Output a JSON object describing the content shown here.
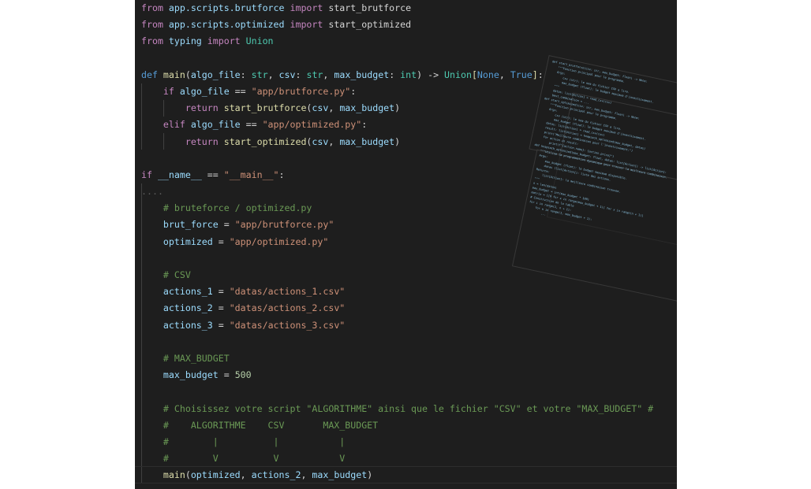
{
  "code_lines": [
    {
      "type": "import1",
      "text": "from app.scripts.brutforce import start_brutforce"
    },
    {
      "type": "import2",
      "text": "from app.scripts.optimized import start_optimized"
    },
    {
      "type": "import3",
      "text": "from typing import Union"
    },
    {
      "type": "blank",
      "text": ""
    },
    {
      "type": "def",
      "text": "def main(algo_file: str, csv: str, max_budget: int) -> Union[None, True]:"
    },
    {
      "type": "if",
      "text": "if algo_file == \"app/brutforce.py\":"
    },
    {
      "type": "ret1",
      "text": "return start_brutforce(csv, max_budget)"
    },
    {
      "type": "elif",
      "text": "elif algo_file == \"app/optimized.py\":"
    },
    {
      "type": "ret2",
      "text": "return start_optimized(csv, max_budget)"
    },
    {
      "type": "blank",
      "text": ""
    },
    {
      "type": "ifmain",
      "text": "if __name__ == \"__main__\":"
    },
    {
      "type": "dots",
      "text": "...."
    },
    {
      "type": "cm",
      "text": "# bruteforce / optimized.py"
    },
    {
      "type": "assign",
      "var": "brut_force",
      "value": "\"app/brutforce.py\""
    },
    {
      "type": "assign",
      "var": "optimized",
      "value": "\"app/optimized.py\""
    },
    {
      "type": "blank",
      "text": ""
    },
    {
      "type": "cm",
      "text": "# CSV"
    },
    {
      "type": "assign",
      "var": "actions_1",
      "value": "\"datas/actions_1.csv\""
    },
    {
      "type": "assign",
      "var": "actions_2",
      "value": "\"datas/actions_2.csv\""
    },
    {
      "type": "assign",
      "var": "actions_3",
      "value": "\"datas/actions_3.csv\""
    },
    {
      "type": "blank",
      "text": ""
    },
    {
      "type": "cm",
      "text": "# MAX_BUDGET"
    },
    {
      "type": "assignnum",
      "var": "max_budget",
      "value": "500"
    },
    {
      "type": "blank",
      "text": ""
    },
    {
      "type": "cm",
      "text": "# Choisissez votre script \"ALGORITHME\" ainsi que le fichier \"CSV\" et votre \"MAX_BUDGET\" #"
    },
    {
      "type": "cm",
      "text": "#    ALGORITHME    CSV       MAX_BUDGET"
    },
    {
      "type": "cm",
      "text": "#        |          |           |"
    },
    {
      "type": "cm",
      "text": "#        V          V           V"
    },
    {
      "type": "call",
      "text": "main(optimized, actions_2, max_budget)"
    }
  ],
  "overlay_lines": [
    "def start_brutforce(csv: str, max_budget: float) -> None:",
    "    \"\"\"Fonction principal pour le programme.",
    "    Args:",
    "        csv (str): le nom du fichier CSV a lire.",
    "        max_budget (float): le budget maximum d'investissement.",
    "    \"\"\"",
    "    datas: list[Action] = read_csv(csv)",
    "    best_combination = ...",
    "def start_optimized(csv: str, max_budget: float) -> None:",
    "    \"\"\"Fonction principal pour le programme.",
    "    Args:",
    "        csv (str): le nom du fichier CSV a lire.",
    "        max_budget (float): le budget maximum d'investissement.",
    "    datas: list[Action] = read_csv(csv)",
    "    result: list[Action] = knapsack_optimized(max_budget, datas)",
    "    print(\"Meilleure combinaison pour l'investissement:\")",
    "    for action in result:",
    "        print(f\"{action.name}: {action.price}\")",
    "def knapsack_optimized(max_budget: float, datas: list[Action]) -> list[Action]:",
    "    \"\"\"Utilise la programmation dynamique pour trouver la meilleure combinaison.",
    "    Args:",
    "        max_budget (float): le budget maximum disponible.",
    "        datas (list[Action]): liste des actions.",
    "    Returns:",
    "        list[Action]: la meilleure combinaison trouvee.",
    "    \"\"\"",
    "    n = len(datas)",
    "    max_budget = int(max_budget * 100)",
    "    matrix = [[0 for x in range(max_budget + 1)] for x in range(n + 1)]",
    "    # Construction de la table",
    "    for i in range(1, n + 1):",
    "        for w in range(1, max_budget + 1):",
    "            ..."
  ]
}
